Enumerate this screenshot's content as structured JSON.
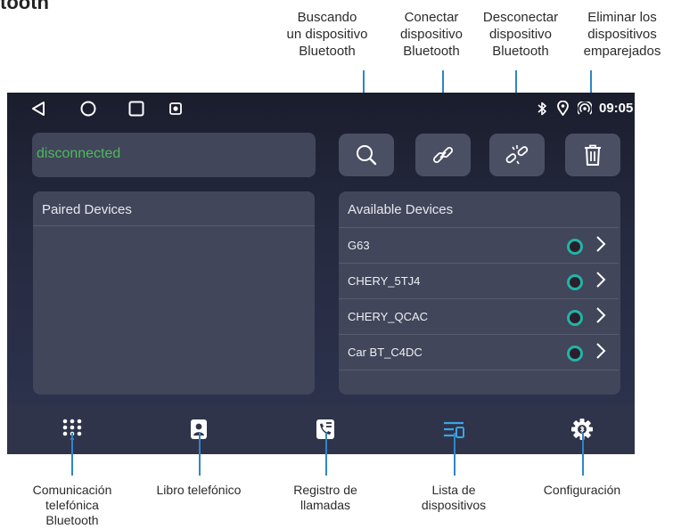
{
  "page_heading": "tooth",
  "callouts": {
    "search": "Buscando\nun dispositivo\nBluetooth",
    "connect": "Conectar\ndispositivo\nBluetooth",
    "disconnect": "Desconectar\ndispositivo\nBluetooth",
    "delete": "Eliminar los\ndispositivos\nemparejados",
    "dialpad": "Comunicación\ntelefónica\nBluetooth",
    "phonebook": "Libro telefónico",
    "call_log": "Registro de\nllamadas",
    "device_list": "Lista de\ndispositivos",
    "settings": "Configuración"
  },
  "status_bar": {
    "time": "09:05",
    "icons": [
      "bluetooth-icon",
      "location-icon",
      "hotspot-icon"
    ]
  },
  "connection_status": "disconnected",
  "paired_devices": {
    "title": "Paired Devices",
    "items": []
  },
  "available_devices": {
    "title": "Available Devices",
    "items": [
      {
        "name": "G63"
      },
      {
        "name": "CHERY_5TJ4"
      },
      {
        "name": "CHERY_QCAC"
      },
      {
        "name": "Car BT_C4DC"
      }
    ]
  },
  "toolbar_icons": [
    "search-icon",
    "link-icon",
    "unlink-icon",
    "trash-icon"
  ],
  "bottom_nav": {
    "items": [
      "dialpad",
      "phonebook",
      "call-log",
      "device-list",
      "settings"
    ],
    "active": "device-list"
  },
  "colors": {
    "status_text": "#4cbb5a",
    "accent": "#2e86c8",
    "active_nav": "#3aa6e6",
    "device_dot": "#23b3a8"
  }
}
